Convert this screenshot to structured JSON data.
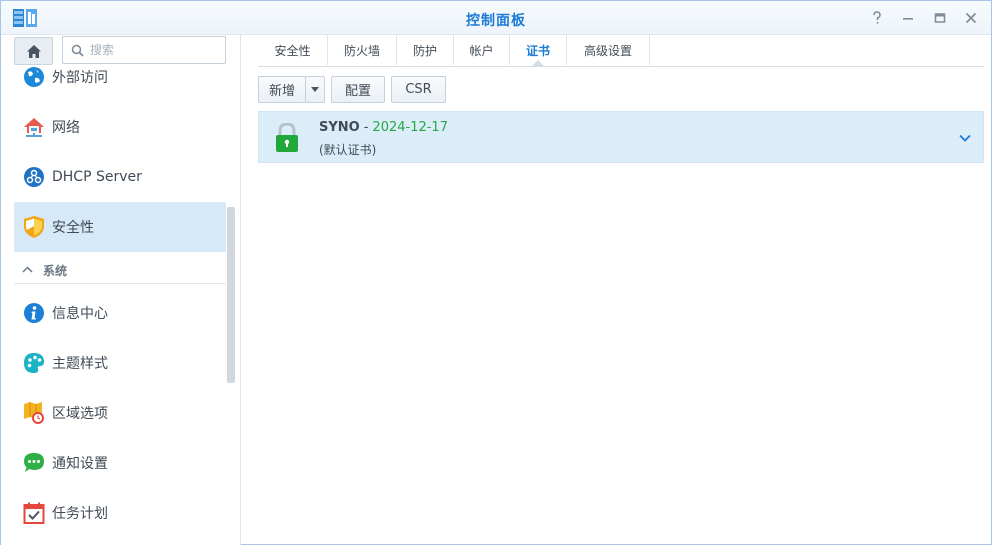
{
  "window": {
    "title": "控制面板",
    "controls": {
      "help": "?",
      "minimize": "—",
      "maximize": "☐",
      "close": "✕"
    }
  },
  "sidebar": {
    "search": {
      "placeholder": "搜索",
      "value": ""
    },
    "items": [
      {
        "label": "外部访问",
        "icon": "globe-icon"
      },
      {
        "label": "网络",
        "icon": "network-house-icon"
      },
      {
        "label": "DHCP Server",
        "icon": "dhcp-icon"
      },
      {
        "label": "安全性",
        "icon": "shield-icon",
        "selected": true
      }
    ],
    "section": {
      "label": "系统",
      "collapse_icon": "chevron-up-icon"
    },
    "system_items": [
      {
        "label": "信息中心",
        "icon": "info-icon"
      },
      {
        "label": "主题样式",
        "icon": "palette-icon"
      },
      {
        "label": "区域选项",
        "icon": "map-clock-icon"
      },
      {
        "label": "通知设置",
        "icon": "chat-bubble-icon"
      },
      {
        "label": "任务计划",
        "icon": "calendar-check-icon"
      }
    ]
  },
  "tabs": [
    {
      "label": "安全性"
    },
    {
      "label": "防火墙"
    },
    {
      "label": "防护"
    },
    {
      "label": "帐户"
    },
    {
      "label": "证书",
      "active": true
    },
    {
      "label": "高级设置"
    }
  ],
  "toolbar": {
    "add_label": "新增",
    "configure_label": "配置",
    "csr_label": "CSR"
  },
  "certificates": [
    {
      "name": "SYNO",
      "separator": "-",
      "expiry": "2024-12-17",
      "description": "(默认证书)",
      "icon": "lock-icon"
    }
  ],
  "colors": {
    "accent": "#1d7bd6",
    "selected_bg": "#d6e9f8",
    "cert_row_bg": "#dcedfa",
    "expiry_green": "#28a745"
  }
}
